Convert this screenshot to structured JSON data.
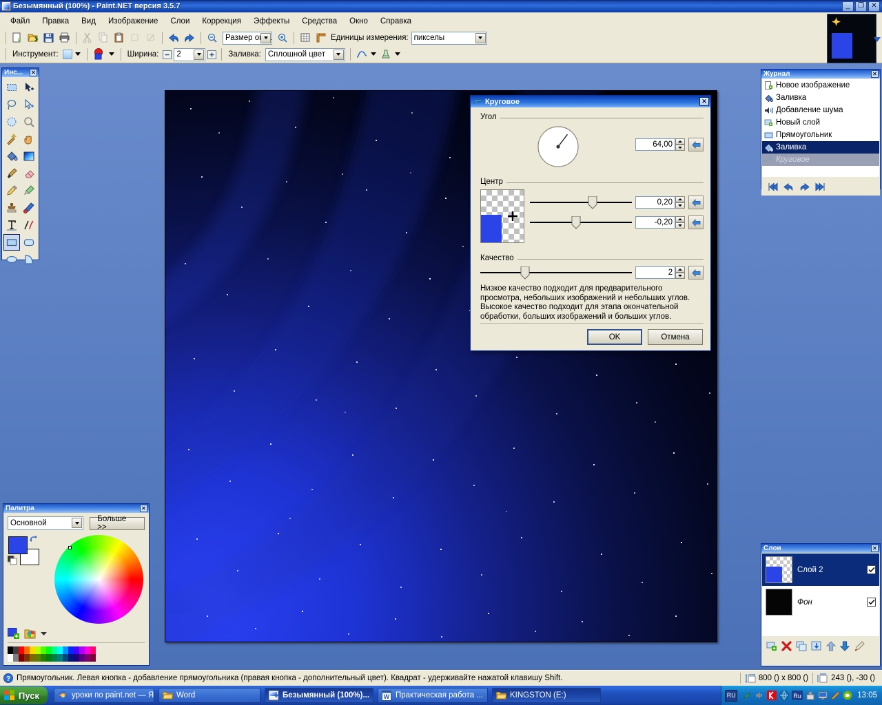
{
  "window": {
    "title": "Безымянный (100%) - Paint.NET версия 3.5.7",
    "minimize": "_",
    "maximize": "❐",
    "close": "✕"
  },
  "menu": {
    "items": [
      "Файл",
      "Правка",
      "Вид",
      "Изображение",
      "Слои",
      "Коррекция",
      "Эффекты",
      "Средства",
      "Окно",
      "Справка"
    ]
  },
  "toolbar": {
    "zoom_combo_value": "Размер окна",
    "units_label": "Единицы измерения:",
    "units_value": "пикселы",
    "tool_label": "Инструмент:",
    "width_label": "Ширина:",
    "width_value": "2",
    "fill_label": "Заливка:",
    "fill_value": "Сплошной цвет",
    "minus": "−",
    "plus": "+",
    "icons": [
      "new-file-icon",
      "open-file-icon",
      "save-icon",
      "print-icon",
      "cut-icon",
      "copy-icon",
      "paste-icon",
      "crop-icon",
      "deselect-icon",
      "undo-icon",
      "redo-icon",
      "zoom-out-icon",
      "zoom-in-icon",
      "grid-icon",
      "rulers-icon"
    ]
  },
  "tools_panel": {
    "title": "Инс...",
    "close": "✕",
    "tools": [
      {
        "name": "rectangle-select-tool",
        "selected": false
      },
      {
        "name": "move-selected-tool",
        "selected": false
      },
      {
        "name": "lasso-select-tool",
        "selected": false
      },
      {
        "name": "move-selection-tool",
        "selected": false
      },
      {
        "name": "ellipse-select-tool",
        "selected": false
      },
      {
        "name": "zoom-tool",
        "selected": false
      },
      {
        "name": "magic-wand-tool",
        "selected": false
      },
      {
        "name": "pan-tool",
        "selected": false
      },
      {
        "name": "paint-bucket-tool",
        "selected": false
      },
      {
        "name": "gradient-tool",
        "selected": false
      },
      {
        "name": "paintbrush-tool",
        "selected": false
      },
      {
        "name": "eraser-tool",
        "selected": false
      },
      {
        "name": "pencil-tool",
        "selected": false
      },
      {
        "name": "color-picker-tool",
        "selected": false
      },
      {
        "name": "clone-stamp-tool",
        "selected": false
      },
      {
        "name": "recolor-tool",
        "selected": false
      },
      {
        "name": "text-tool",
        "selected": false
      },
      {
        "name": "line-curve-tool",
        "selected": false
      },
      {
        "name": "rectangle-tool",
        "selected": true
      },
      {
        "name": "rounded-rectangle-tool",
        "selected": false
      },
      {
        "name": "ellipse-tool",
        "selected": false
      },
      {
        "name": "freeform-shape-tool",
        "selected": false
      }
    ]
  },
  "dialog": {
    "title": "Круговое",
    "close": "✕",
    "angle": {
      "group_label": "Угол",
      "value": "64,00",
      "reset_icon": "reset-arrow-icon",
      "dial_angle_deg": 64
    },
    "center": {
      "group_label": "Центр",
      "x_value": "0,20",
      "y_value": "-0,20",
      "x_slider_pct": 60,
      "y_slider_pct": 45,
      "reset_icon": "reset-arrow-icon"
    },
    "quality": {
      "group_label": "Качество",
      "value": "2",
      "slider_pct": 30,
      "reset_icon": "reset-arrow-icon",
      "description": "Низкое качество подходит для предварительного просмотра, небольших изображений и небольших углов. Высокое качество подходит для этапа окончательной обработки, больших изображений и больших углов."
    },
    "ok_label": "OK",
    "cancel_label": "Отмена"
  },
  "history_panel": {
    "title": "Журнал",
    "close": "✕",
    "items": [
      {
        "label": "Новое изображение",
        "icon": "new-image-icon",
        "state": "normal"
      },
      {
        "label": "Заливка",
        "icon": "paint-bucket-icon",
        "state": "normal"
      },
      {
        "label": "Добавление шума",
        "icon": "add-noise-icon",
        "state": "normal"
      },
      {
        "label": "Новый слой",
        "icon": "new-layer-icon",
        "state": "normal"
      },
      {
        "label": "Прямоугольник",
        "icon": "rectangle-icon",
        "state": "normal"
      },
      {
        "label": "Заливка",
        "icon": "paint-bucket-icon",
        "state": "selected"
      },
      {
        "label": "Круговое",
        "icon": "twist-icon",
        "state": "undone"
      }
    ],
    "buttons": [
      "rewind-to-start-icon",
      "undo-icon",
      "redo-icon",
      "forward-to-end-icon"
    ]
  },
  "layers_panel": {
    "title": "Слои",
    "close": "✕",
    "layers": [
      {
        "name": "Слой 2",
        "visible": true,
        "selected": true,
        "thumb": "checkered-blue-square"
      },
      {
        "name": "Фон",
        "visible": true,
        "selected": false,
        "thumb": "black"
      }
    ],
    "checkmark": "✔",
    "buttons": [
      "add-layer-icon",
      "delete-layer-icon",
      "duplicate-layer-icon",
      "merge-layer-down-icon",
      "move-layer-up-icon",
      "move-layer-down-icon",
      "layer-properties-icon"
    ]
  },
  "palette_panel": {
    "title": "Палитра",
    "close": "✕",
    "mode_value": "Основной",
    "more_label": "Больше >>",
    "primary_color": "#2b44e8",
    "secondary_color": "#ffffff",
    "swap_icon": "swap-colors-icon",
    "reset_icon": "reset-colors-icon",
    "add_color_icon": "add-color-icon",
    "palette_open_icon": "open-palette-icon",
    "swatches_row1": [
      "#000000",
      "#404040",
      "#ff0000",
      "#ff6a00",
      "#ffd800",
      "#b6ff00",
      "#4cff00",
      "#00ff21",
      "#00ff90",
      "#00ffff",
      "#0094ff",
      "#0026ff",
      "#4800ff",
      "#b200ff",
      "#ff00dc",
      "#ff006e"
    ],
    "swatches_row2": [
      "#ffffff",
      "#808080",
      "#7f0000",
      "#7f3300",
      "#7f6a00",
      "#5b7f00",
      "#267f00",
      "#007f0e",
      "#007f46",
      "#007f7f",
      "#004a7f",
      "#00137f",
      "#21007f",
      "#57007f",
      "#7f006e",
      "#7f0037"
    ]
  },
  "statusbar": {
    "help_icon": "help-icon",
    "help_text": "Прямоугольник. Левая кнопка - добавление прямоугольника (правая кнопка - дополнительный цвет). Квадрат - удерживайте нажатой клавишу Shift.",
    "size_icon": "image-size-icon",
    "size_text": "800 () x 800 ()",
    "cursor_icon": "cursor-position-icon",
    "cursor_text": "243 (), -30 ()"
  },
  "taskbar": {
    "start_label": "Пуск",
    "items": [
      {
        "label": "уроки по paint.net — Я...",
        "icon": "firefox-icon",
        "active": false
      },
      {
        "label": "Word",
        "icon": "folder-icon",
        "active": false
      },
      {
        "label": "Безымянный (100%)...",
        "icon": "paintnet-icon",
        "active": true
      },
      {
        "label": "Практическая работа ...",
        "icon": "word-icon",
        "active": false
      },
      {
        "label": "KINGSTON (E:)",
        "icon": "folder-icon",
        "active": false
      }
    ],
    "language": "RU",
    "tray_icons": [
      "antivirus-icon",
      "speaker-icon",
      "kaspersky-icon",
      "globe-icon",
      "lang-ru-icon",
      "usb-icon",
      "monitor-icon",
      "pencil-icon",
      "nvidia-icon"
    ],
    "clock": "13:05"
  },
  "colors": {
    "title_blue": "#0a246a",
    "face": "#ece9d8",
    "accent_blue": "#2b44e8",
    "selection": "#0a246a",
    "desktop": "#5984c6"
  },
  "thumbnail": {
    "name": "image-thumbnail",
    "bg": "#05070f",
    "rect_color": "#2b44e8"
  }
}
